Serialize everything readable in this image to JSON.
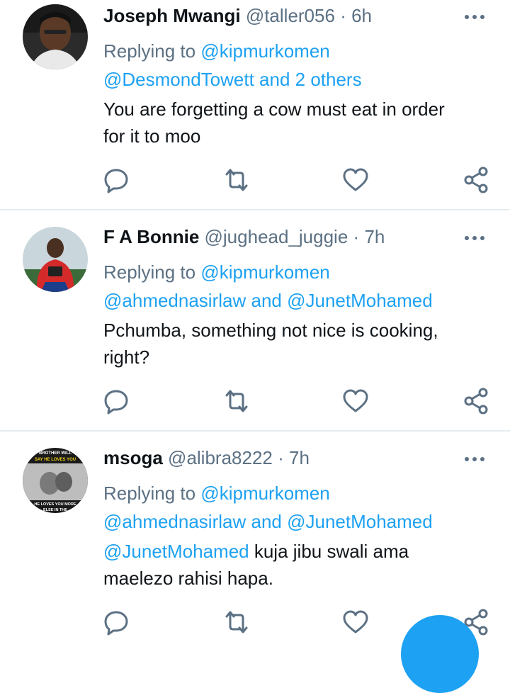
{
  "tweets": [
    {
      "name": "Joseph Mwangi",
      "handle": "@taller056",
      "sep": "·",
      "time": "6h",
      "replying_prefix": "Replying to",
      "replying_line1": "@kipmurkomen",
      "replying_line2": "@DesmondTowett and 2 others",
      "body_line1": "You are forgetting a cow must eat in order",
      "body_line2": "for it to moo"
    },
    {
      "name": "F A Bonnie",
      "handle": "@jughead_juggie",
      "sep": "·",
      "time": "7h",
      "replying_prefix": "Replying to",
      "replying_line1": "@kipmurkomen",
      "replying_line2": "@ahmednasirlaw and @JunetMohamed",
      "body_line1": "Pchumba, something not nice is cooking,",
      "body_line2": "right?"
    },
    {
      "name": "msoga",
      "handle": "@alibra8222",
      "sep": "·",
      "time": "7h",
      "replying_prefix": "Replying to",
      "replying_line1": "@kipmurkomen",
      "replying_line2": "@ahmednasirlaw and @JunetMohamed",
      "body_mention": "@JunetMohamed",
      "body_line1_rest": " kuja jibu swali ama",
      "body_line2": "maelezo rahisi hapa.",
      "avatar_text_top1": "BROTHER WILL",
      "avatar_text_top2": "SAY HE LOVES YOU",
      "avatar_text_bottom1": "HE LOVES YOU MORE",
      "avatar_text_bottom2": "ELSE IN THE"
    }
  ],
  "icons": {
    "reply": "reply-icon",
    "retweet": "retweet-icon",
    "like": "like-icon",
    "share": "share-icon",
    "more": "more-icon"
  },
  "colors": {
    "accent": "#1da1f2",
    "secondary_text": "#5b7083",
    "divider": "#e6ecf0"
  }
}
